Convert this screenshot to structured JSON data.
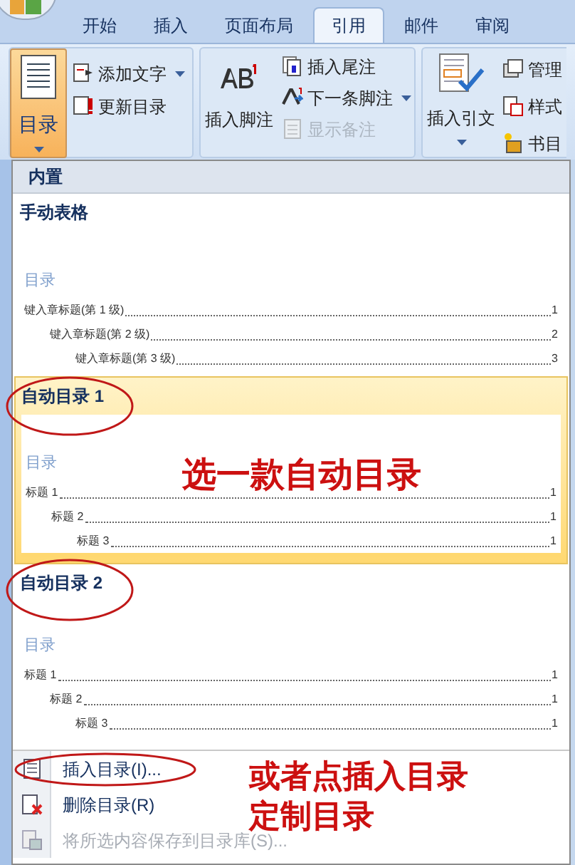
{
  "tabs": [
    {
      "label": "开始",
      "selected": false
    },
    {
      "label": "插入",
      "selected": false
    },
    {
      "label": "页面布局",
      "selected": false
    },
    {
      "label": "引用",
      "selected": true
    },
    {
      "label": "邮件",
      "selected": false
    },
    {
      "label": "审阅",
      "selected": false
    }
  ],
  "ribbon": {
    "toc_button": {
      "label": "目录",
      "pressed": true
    },
    "toc_commands": [
      {
        "label": "添加文字",
        "dropdown": true,
        "disabled": false
      },
      {
        "label": "更新目录",
        "dropdown": false,
        "disabled": false
      }
    ],
    "footnote_button": {
      "label": "插入脚注"
    },
    "footnote_commands": [
      {
        "label": "插入尾注",
        "dropdown": false,
        "disabled": false
      },
      {
        "label": "下一条脚注",
        "dropdown": true,
        "disabled": false
      },
      {
        "label": "显示备注",
        "dropdown": false,
        "disabled": true
      }
    ],
    "citation_button": {
      "label": "插入引文"
    },
    "citation_commands": [
      {
        "label": "管理"
      },
      {
        "label": "样式"
      },
      {
        "label": "书目"
      }
    ]
  },
  "gallery": {
    "header": "内置",
    "entries": [
      {
        "title": "手动表格",
        "selected": false,
        "heading": "目录",
        "lines": [
          {
            "text": "键入章标题(第 1 级)",
            "page": "1",
            "children": [
              {
                "text": "键入章标题(第 2 级)",
                "page": "2",
                "children": [
                  {
                    "text": "键入章标题(第 3 级)",
                    "page": "3"
                  }
                ]
              }
            ]
          }
        ]
      },
      {
        "title": "自动目录 1",
        "selected": true,
        "heading": "目录",
        "lines": [
          {
            "text": "标题 1",
            "page": "1",
            "children": [
              {
                "text": "标题 2",
                "page": "1",
                "children": [
                  {
                    "text": "标题 3",
                    "page": "1"
                  }
                ]
              }
            ]
          }
        ]
      },
      {
        "title": "自动目录 2",
        "selected": false,
        "heading": "目录",
        "lines": [
          {
            "text": "标题 1",
            "page": "1",
            "children": [
              {
                "text": "标题 2",
                "page": "1",
                "children": [
                  {
                    "text": "标题 3",
                    "page": "1"
                  }
                ]
              }
            ]
          }
        ]
      }
    ]
  },
  "menu_items": [
    {
      "label": "插入目录(I)...",
      "kind": "insert",
      "disabled": false
    },
    {
      "label": "删除目录(R)",
      "kind": "remove",
      "disabled": false
    },
    {
      "label": "将所选内容保存到目录库(S)...",
      "kind": "save",
      "disabled": true
    }
  ],
  "annotations": [
    {
      "text": "选一款自动目录",
      "kind": "gallery-note"
    },
    {
      "text": "或者点插入目录",
      "kind": "menu-note"
    },
    {
      "text": "定制目录",
      "kind": "menu-note"
    }
  ]
}
